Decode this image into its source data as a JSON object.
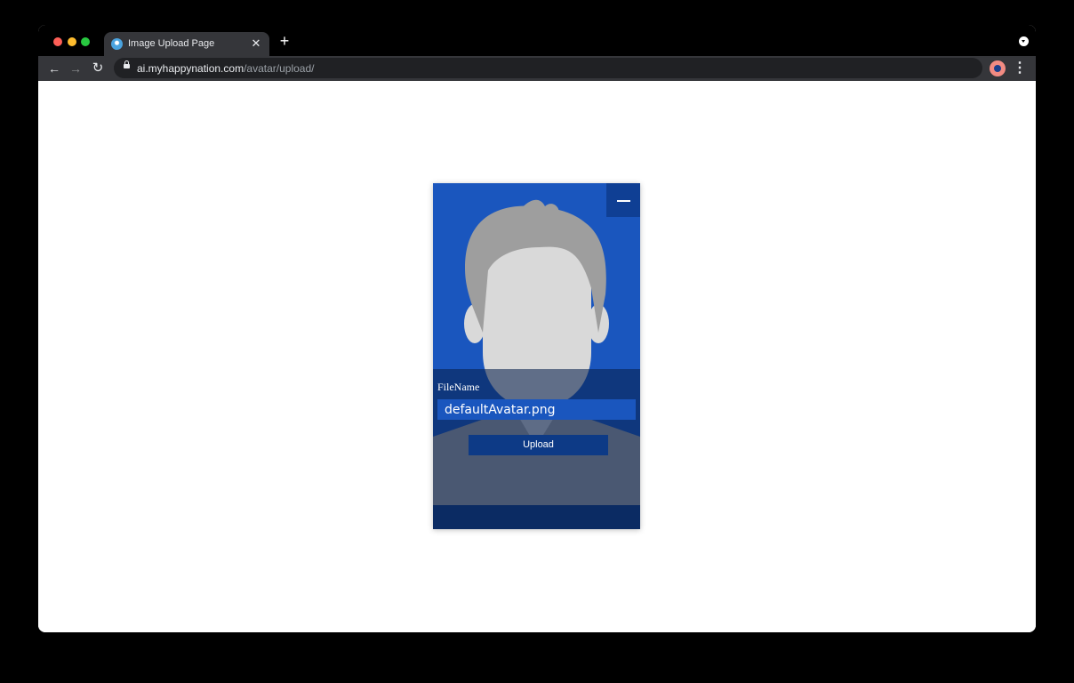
{
  "browser": {
    "tab_title": "Image Upload Page",
    "tab_close_symbol": "✕",
    "new_tab_symbol": "+",
    "url_host": "ai.myhappynation.com",
    "url_path": "/avatar/upload/",
    "back_symbol": "←",
    "forward_symbol": "→",
    "reload_symbol": "↻",
    "star_symbol": "☆",
    "menu_symbol": "⋮"
  },
  "card": {
    "filename_label": "FileName",
    "filename_value": "defaultAvatar.png",
    "upload_label": "Upload",
    "collapse_icon": "minus-icon"
  },
  "colors": {
    "card_blue": "#1a56be",
    "dark_blue": "#0b2b63"
  }
}
